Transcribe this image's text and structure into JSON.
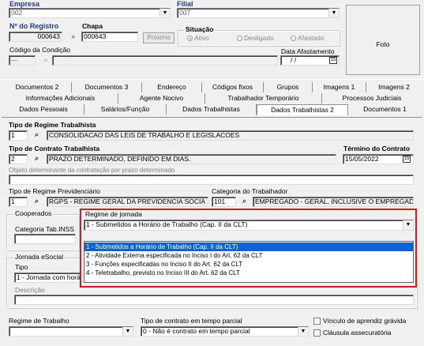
{
  "top": {
    "empresa_label": "Empresa",
    "empresa_value": "002",
    "filial_label": "Filial",
    "filial_value": "007",
    "registro_label": "Nº do Registro",
    "registro_value": "000643",
    "chapa_label": "Chapa",
    "chapa_value": "000643",
    "proximo_label": "Próximo",
    "situacao_label": "Situação",
    "situacao_options": [
      "Ativo",
      "Desligado",
      "Afastado"
    ],
    "condicao_label": "Código da Condição",
    "condicao_value": "—",
    "data_afastamento_label": "Data Afastamento",
    "data_afastamento_value": "/ /",
    "foto_label": "Foto"
  },
  "tabs": {
    "row1": [
      "Documentos 2",
      "Documentos 3",
      "Endereço",
      "Códigos fixos",
      "Grupos",
      "Imagens 1",
      "Imagens 2"
    ],
    "row2": [
      "Informações Adicionais",
      "Agente Nocivo",
      "Trabalhador Temporário",
      "Processos Judiciais"
    ],
    "row3": [
      "Dados Pessoais",
      "Salários/Função",
      "Dados Trabalhistas",
      "Dados Trabalhistas 2",
      "Documentos 1"
    ]
  },
  "form": {
    "regime_trab_label": "Tipo de Regime Trabalhista",
    "regime_trab_code": "1",
    "regime_trab_desc": "CONSOLIDACAO DAS LEIS DE TRABALHO E LEGISLACOES",
    "contrato_label": "Tipo de Contrato Trabalhista",
    "contrato_code": "2",
    "contrato_desc": "PRAZO DETERMINADO, DEFINIDO EM DIAS.",
    "termino_label": "Término do Contrato",
    "termino_value": "15/05/2022",
    "objeto_label": "Objeto determinante da contratação por prazo determinado",
    "prev_label": "Tipo de Regime Previdenciário",
    "prev_code": "1",
    "prev_desc": "RGPS - REGIME GERAL DA PREVIDENCIA SOCIA",
    "categoria_label": "Categoria do Trabalhador",
    "categoria_code": "101",
    "categoria_desc": "EMPREGADO - GERAL, INCLUSIVE O EMPREGAD",
    "cooperados_label": "Cooperados",
    "cat_inss_label": "Categoria Tab.INSS",
    "jornada_esocial_label": "Jornada eSocial",
    "tipo_label": "Tipo",
    "tipo_value": "1 - Jornada com horá",
    "descricao_label": "Descrição",
    "regime_trabalho_label": "Regime de Trabalho",
    "tipo_parcial_label": "Tipo de contrato em tempo parcial",
    "tipo_parcial_value": "0 - Não é contrato em tempo parcial",
    "vinculo_label": "Vínculo de aprendiz grávida",
    "clausula_label": "Cláusula assecuratória"
  },
  "regime_jornada": {
    "label": "Regime de jornada",
    "selected": "1 - Submetidos a Horário de Trabalho (Cap. II da CLT)",
    "options": [
      "1 - Submetidos a Horário de Trabalho (Cap. II da CLT)",
      "2 - Atividade Externa especificada no Inciso I do Art. 62 da CLT",
      "3 - Funções especificadas no Inciso II do Art. 62 da CLT",
      "4 - Teletrabalho, previsto no Inciso III do Art. 62 da CLT"
    ],
    "highlight_color": "#e0161b",
    "selection_color": "#0a64d6"
  }
}
